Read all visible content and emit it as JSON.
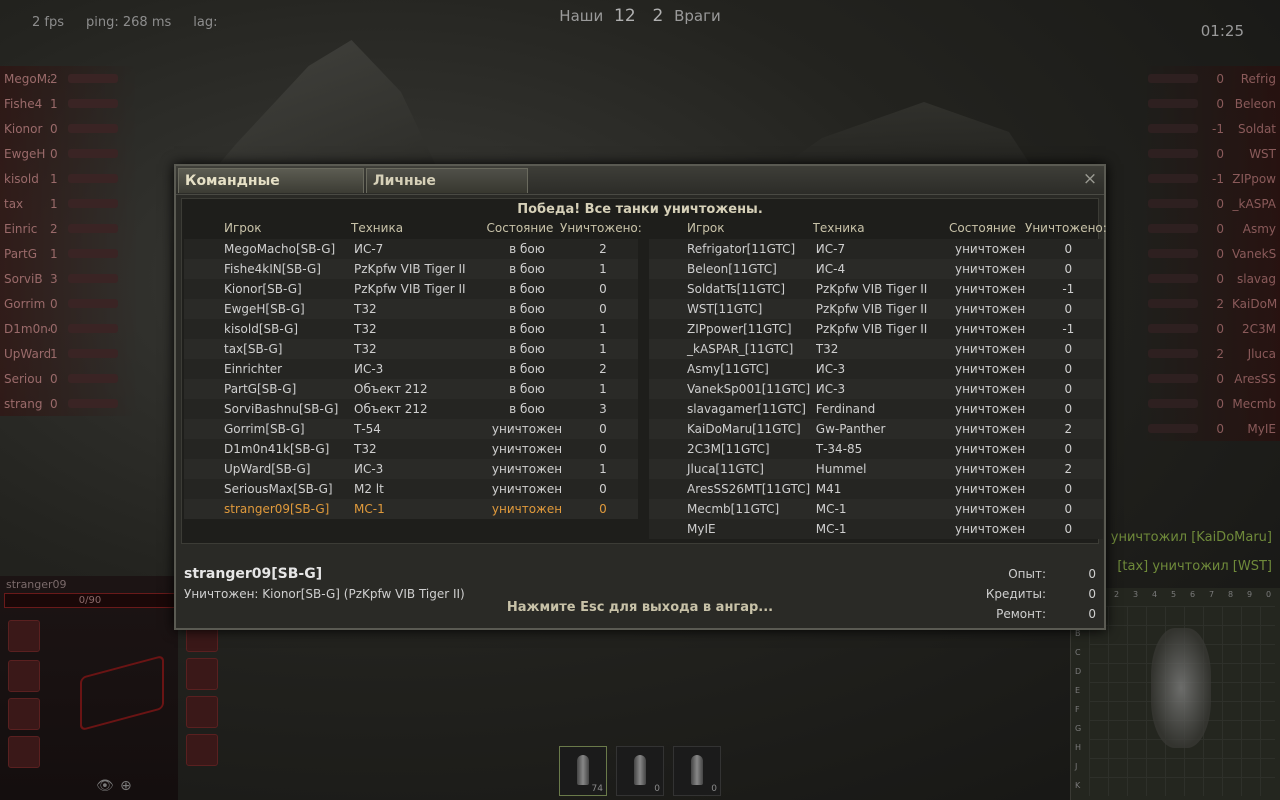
{
  "hud": {
    "fps": "2 fps",
    "ping": "ping: 268 ms",
    "lag": "lag:",
    "ours_label": "Наши",
    "ours_count": "12",
    "enemy_count": "2",
    "enemy_label": "Враги",
    "timer": "01:25"
  },
  "side_left": [
    {
      "name": "MegoMa",
      "frags": "2"
    },
    {
      "name": "Fishe4",
      "frags": "1"
    },
    {
      "name": "Kionor",
      "frags": "0"
    },
    {
      "name": "EwgeH",
      "frags": "0"
    },
    {
      "name": "kisold",
      "frags": "1"
    },
    {
      "name": "tax",
      "frags": "1"
    },
    {
      "name": "Einric",
      "frags": "2"
    },
    {
      "name": "PartG",
      "frags": "1"
    },
    {
      "name": "SorviB",
      "frags": "3"
    },
    {
      "name": "Gorrim",
      "frags": "0"
    },
    {
      "name": "D1m0n4",
      "frags": "0"
    },
    {
      "name": "UpWard",
      "frags": "1"
    },
    {
      "name": "Seriou",
      "frags": "0"
    },
    {
      "name": "strang",
      "frags": "0"
    }
  ],
  "side_right": [
    {
      "name": "Refrig",
      "frags": "0"
    },
    {
      "name": "Beleon",
      "frags": "0"
    },
    {
      "name": "Soldat",
      "frags": "-1"
    },
    {
      "name": "WST",
      "frags": "0"
    },
    {
      "name": "ZIPpow",
      "frags": "-1"
    },
    {
      "name": "_kASPA",
      "frags": "0"
    },
    {
      "name": "Asmy",
      "frags": "0"
    },
    {
      "name": "VanekS",
      "frags": "0"
    },
    {
      "name": "slavag",
      "frags": "0"
    },
    {
      "name": "KaiDoM",
      "frags": "2"
    },
    {
      "name": "2C3M",
      "frags": "0"
    },
    {
      "name": "Jluca",
      "frags": "2"
    },
    {
      "name": "AresSS",
      "frags": "0"
    },
    {
      "name": "Mecmb",
      "frags": "0"
    },
    {
      "name": "MyIE",
      "frags": "0"
    }
  ],
  "damage_panel": {
    "player": "stranger09",
    "hp": "0/90"
  },
  "killfeed": [
    "[kisold] уничтожил [KaiDoMaru]",
    "[tax] уничтожил [WST]"
  ],
  "ammo": [
    {
      "count": "74"
    },
    {
      "count": "0"
    },
    {
      "count": "0"
    }
  ],
  "minimap": {
    "letters": [
      "A",
      "B",
      "C",
      "D",
      "E",
      "F",
      "G",
      "H",
      "J",
      "K"
    ],
    "numbers": [
      "1",
      "2",
      "3",
      "4",
      "5",
      "6",
      "7",
      "8",
      "9",
      "0"
    ]
  },
  "dialog": {
    "tabs": [
      "Командные достижения",
      "Личные достижения"
    ],
    "close": "×",
    "result": "Победа! Все танки уничтожены.",
    "headers": {
      "player": "Игрок",
      "vehicle": "Техника",
      "state": "Состояние",
      "kills": "Уничтожено:"
    },
    "team_left": [
      {
        "player": "MegoMacho[SB-G]",
        "vehicle": "ИС-7",
        "state": "в бою",
        "kills": "2"
      },
      {
        "player": "Fishe4kIN[SB-G]",
        "vehicle": "PzKpfw VIB Tiger II",
        "state": "в бою",
        "kills": "1"
      },
      {
        "player": "Kionor[SB-G]",
        "vehicle": "PzKpfw VIB Tiger II",
        "state": "в бою",
        "kills": "0"
      },
      {
        "player": "EwgeH[SB-G]",
        "vehicle": "T32",
        "state": "в бою",
        "kills": "0"
      },
      {
        "player": "kisold[SB-G]",
        "vehicle": "T32",
        "state": "в бою",
        "kills": "1"
      },
      {
        "player": "tax[SB-G]",
        "vehicle": "T32",
        "state": "в бою",
        "kills": "1"
      },
      {
        "player": "Einrichter",
        "vehicle": "ИС-3",
        "state": "в бою",
        "kills": "2"
      },
      {
        "player": "PartG[SB-G]",
        "vehicle": "Объект 212",
        "state": "в бою",
        "kills": "1"
      },
      {
        "player": "SorviBashnu[SB-G]",
        "vehicle": "Объект 212",
        "state": "в бою",
        "kills": "3"
      },
      {
        "player": "Gorrim[SB-G]",
        "vehicle": "Т-54",
        "state": "уничтожен",
        "kills": "0"
      },
      {
        "player": "D1m0n41k[SB-G]",
        "vehicle": "T32",
        "state": "уничтожен",
        "kills": "0"
      },
      {
        "player": "UpWard[SB-G]",
        "vehicle": "ИС-3",
        "state": "уничтожен",
        "kills": "1"
      },
      {
        "player": "SeriousMax[SB-G]",
        "vehicle": "M2 lt",
        "state": "уничтожен",
        "kills": "0"
      },
      {
        "player": "stranger09[SB-G]",
        "vehicle": "МС-1",
        "state": "уничтожен",
        "kills": "0",
        "me": true
      }
    ],
    "team_right": [
      {
        "player": "Refrigator[11GTC]",
        "vehicle": "ИС-7",
        "state": "уничтожен",
        "kills": "0"
      },
      {
        "player": "Beleon[11GTC]",
        "vehicle": "ИС-4",
        "state": "уничтожен",
        "kills": "0"
      },
      {
        "player": "SoldatTs[11GTC]",
        "vehicle": "PzKpfw VIB Tiger II",
        "state": "уничтожен",
        "kills": "-1"
      },
      {
        "player": "WST[11GTC]",
        "vehicle": "PzKpfw VIB Tiger II",
        "state": "уничтожен",
        "kills": "0"
      },
      {
        "player": "ZIPpower[11GTC]",
        "vehicle": "PzKpfw VIB Tiger II",
        "state": "уничтожен",
        "kills": "-1"
      },
      {
        "player": "_kASPAR_[11GTC]",
        "vehicle": "T32",
        "state": "уничтожен",
        "kills": "0"
      },
      {
        "player": "Asmy[11GTC]",
        "vehicle": "ИС-3",
        "state": "уничтожен",
        "kills": "0"
      },
      {
        "player": "VanekSp001[11GTC]",
        "vehicle": "ИС-3",
        "state": "уничтожен",
        "kills": "0"
      },
      {
        "player": "slavagamer[11GTC]",
        "vehicle": "Ferdinand",
        "state": "уничтожен",
        "kills": "0"
      },
      {
        "player": "KaiDoMaru[11GTC]",
        "vehicle": "Gw-Panther",
        "state": "уничтожен",
        "kills": "2"
      },
      {
        "player": "2C3M[11GTC]",
        "vehicle": "Т-34-85",
        "state": "уничтожен",
        "kills": "0"
      },
      {
        "player": "Jluca[11GTC]",
        "vehicle": "Hummel",
        "state": "уничтожен",
        "kills": "2"
      },
      {
        "player": "AresSS26MT[11GTC]",
        "vehicle": "M41",
        "state": "уничтожен",
        "kills": "0"
      },
      {
        "player": "Mecmb[11GTC]",
        "vehicle": "МС-1",
        "state": "уничтожен",
        "kills": "0"
      },
      {
        "player": "MyIE",
        "vehicle": "МС-1",
        "state": "уничтожен",
        "kills": "0"
      }
    ],
    "footer": {
      "player": "stranger09[SB-G]",
      "killed_by": "Уничтожен: Kionor[SB-G] (PzKpfw VIB Tiger II)",
      "esc_hint": "Нажмите Esc для выхода в ангар...",
      "stats": [
        {
          "label": "Опыт:",
          "value": "0"
        },
        {
          "label": "Кредиты:",
          "value": "0"
        },
        {
          "label": "Ремонт:",
          "value": "0"
        }
      ]
    }
  },
  "colors": {
    "me_highlight": "#e09a3c",
    "killfeed": "#6f8a3a"
  }
}
